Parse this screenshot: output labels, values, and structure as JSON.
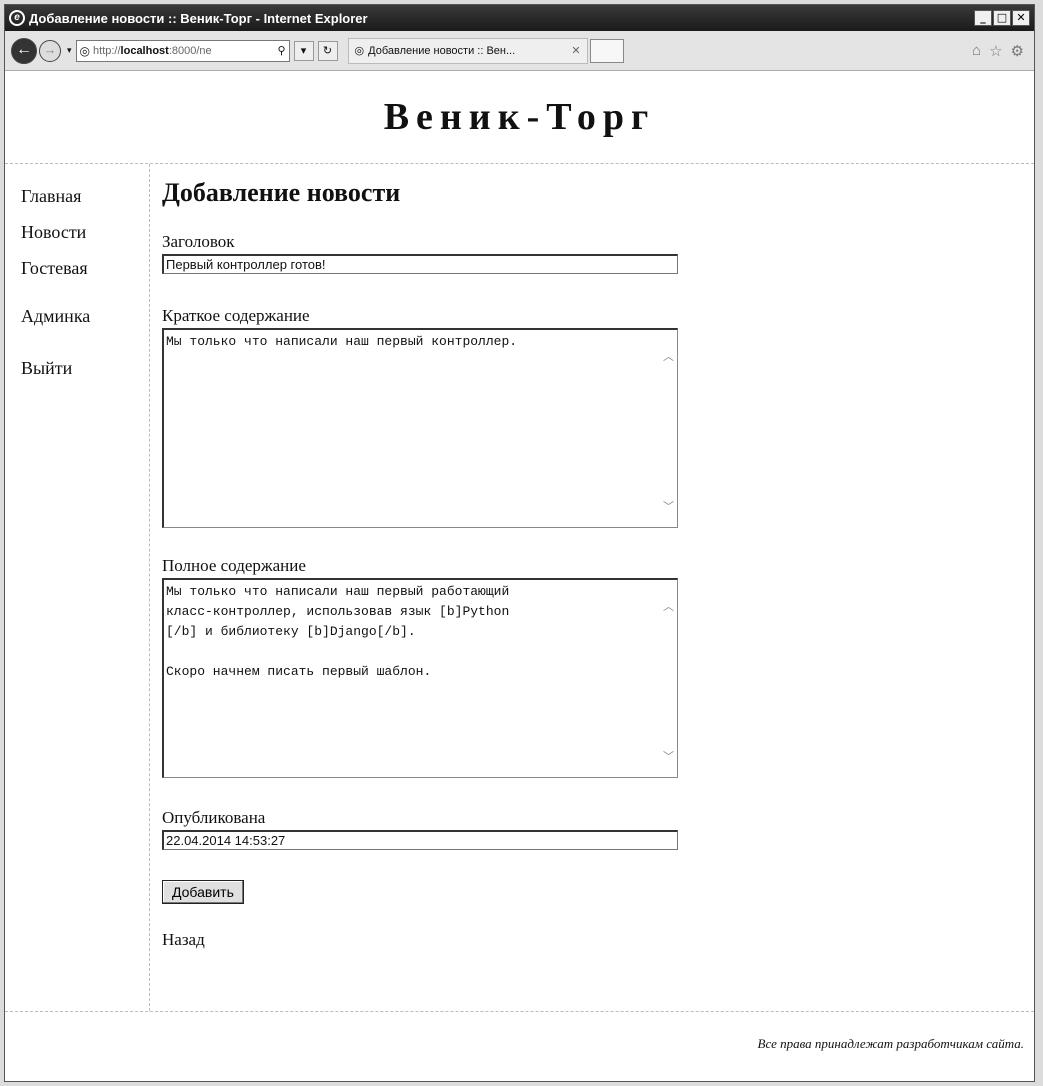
{
  "window": {
    "title": "Добавление новости :: Веник-Торг - Internet Explorer",
    "logo_glyph": "e",
    "controls": {
      "minimize": "_",
      "maximize": "□",
      "close": "✕"
    }
  },
  "browser": {
    "address": {
      "prefix": "http://",
      "host": "localhost",
      "rest": ":8000/ne",
      "search_icon": "⚲",
      "dropdown": "▾"
    },
    "refresh": "↻",
    "tab": {
      "title": "Добавление новости :: Вен...",
      "close": "✕"
    },
    "icons": {
      "home": "⌂",
      "favorites": "☆",
      "tools": "⚙"
    }
  },
  "site": {
    "title": "Веник-Торг",
    "nav": [
      "Главная",
      "Новости",
      "Гостевая",
      "Админка",
      "Выйти"
    ]
  },
  "form": {
    "heading": "Добавление новости",
    "title_label": "Заголовок",
    "title_value": "Первый контроллер готов!",
    "summary_label": "Краткое содержание",
    "summary_value": "Мы только что написали наш первый контроллер.",
    "content_label": "Полное содержание",
    "content_value": "Мы только что написали наш первый работающий\nкласс-контроллер, использовав язык [b]Python\n[/b] и библиотеку [b]Django[/b].\n\nСкоро начнем писать первый шаблон.",
    "published_label": "Опубликована",
    "published_value": "22.04.2014 14:53:27",
    "submit_label": "Добавить",
    "back_link": "Назад"
  },
  "footer": {
    "text": "Все права принадлежат разработчикам сайта."
  }
}
